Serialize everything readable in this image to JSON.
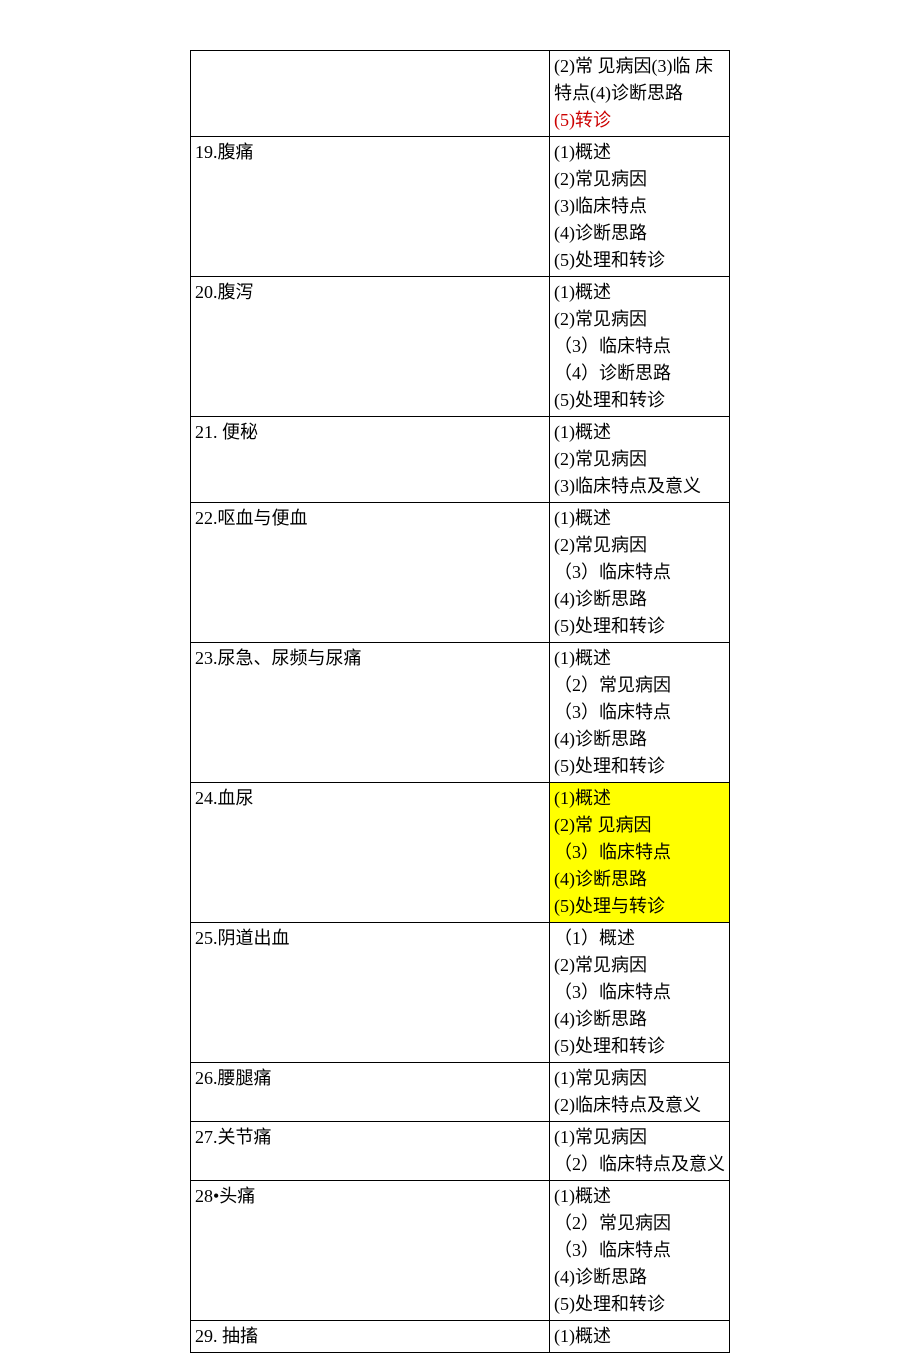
{
  "rows": [
    {
      "left": "",
      "right_pre_html": "(2)常 见病因(3)临 床<br>特点(4)诊断思路<br>",
      "right_red": "(5)转诊",
      "right_highlight": false
    },
    {
      "left": "19.腹痛",
      "right": [
        "(1)概述",
        "(2)常见病因",
        "(3)临床特点",
        "(4)诊断思路",
        "(5)处理和转诊"
      ],
      "right_highlight": false
    },
    {
      "left": "20.腹泻",
      "right": [
        "(1)概述",
        "(2)常见病因",
        "（3）临床特点",
        "（4）诊断思路",
        "(5)处理和转诊"
      ],
      "right_highlight": false
    },
    {
      "left": "21. 便秘",
      "right": [
        "(1)概述",
        "(2)常见病因",
        "(3)临床特点及意义"
      ],
      "right_highlight": false
    },
    {
      "left": "22.呕血与便血",
      "right": [
        "(1)概述",
        "(2)常见病因",
        "（3）临床特点",
        "(4)诊断思路",
        "(5)处理和转诊"
      ],
      "right_highlight": false
    },
    {
      "left": "23.尿急、尿频与尿痛",
      "right": [
        "(1)概述",
        "（2）常见病因",
        "（3）临床特点",
        "(4)诊断思路",
        "(5)处理和转诊"
      ],
      "right_highlight": false
    },
    {
      "left": "24.血尿",
      "right": [
        "(1)概述",
        "(2)常 见病因",
        "（3）临床特点",
        "(4)诊断思路",
        "(5)处理与转诊"
      ],
      "right_highlight": true
    },
    {
      "left": "25.阴道出血",
      "right": [
        "（1）概述",
        "(2)常见病因",
        "（3）临床特点",
        "(4)诊断思路",
        "(5)处理和转诊"
      ],
      "right_highlight": false
    },
    {
      "left": "26.腰腿痛",
      "right": [
        "(1)常见病因",
        "(2)临床特点及意义"
      ],
      "right_highlight": false
    },
    {
      "left": "27.关节痛",
      "right": [
        "(1)常见病因",
        "（2）临床特点及意义"
      ],
      "right_highlight": false
    },
    {
      "left": "28•头痛",
      "right": [
        "(1)概述",
        "（2）常见病因",
        "（3）临床特点",
        "(4)诊断思路",
        "(5)处理和转诊"
      ],
      "right_highlight": false
    },
    {
      "left": "29. 抽搐",
      "right": [
        "(1)概述"
      ],
      "right_highlight": false
    }
  ]
}
